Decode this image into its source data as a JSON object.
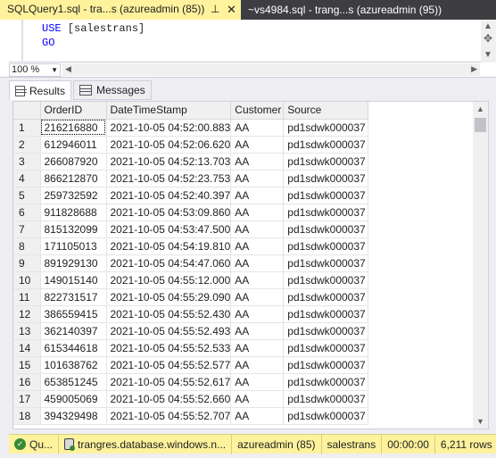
{
  "tabs": {
    "active": {
      "label": "SQLQuery1.sql - tra...s (azureadmin (85))",
      "pin": "⊥",
      "close": "✕"
    },
    "inactive": {
      "label": "~vs4984.sql - trang...s (azureadmin (95))"
    }
  },
  "editor": {
    "line1_keyword": "USE",
    "line1_rest": " [salestrans]",
    "line2_keyword": "GO"
  },
  "zoom": {
    "value": "100 %"
  },
  "results_tabs": {
    "results": "Results",
    "messages": "Messages"
  },
  "grid": {
    "columns": [
      "",
      "OrderID",
      "DateTimeStamp",
      "Customer",
      "Source"
    ],
    "rows": [
      [
        "1",
        "216216880",
        "2021-10-05 04:52:00.883",
        "AA",
        "pd1sdwk000037"
      ],
      [
        "2",
        "612946011",
        "2021-10-05 04:52:06.620",
        "AA",
        "pd1sdwk000037"
      ],
      [
        "3",
        "266087920",
        "2021-10-05 04:52:13.703",
        "AA",
        "pd1sdwk000037"
      ],
      [
        "4",
        "866212870",
        "2021-10-05 04:52:23.753",
        "AA",
        "pd1sdwk000037"
      ],
      [
        "5",
        "259732592",
        "2021-10-05 04:52:40.397",
        "AA",
        "pd1sdwk000037"
      ],
      [
        "6",
        "911828688",
        "2021-10-05 04:53:09.860",
        "AA",
        "pd1sdwk000037"
      ],
      [
        "7",
        "815132099",
        "2021-10-05 04:53:47.500",
        "AA",
        "pd1sdwk000037"
      ],
      [
        "8",
        "171105013",
        "2021-10-05 04:54:19.810",
        "AA",
        "pd1sdwk000037"
      ],
      [
        "9",
        "891929130",
        "2021-10-05 04:54:47.060",
        "AA",
        "pd1sdwk000037"
      ],
      [
        "10",
        "149015140",
        "2021-10-05 04:55:12.000",
        "AA",
        "pd1sdwk000037"
      ],
      [
        "11",
        "822731517",
        "2021-10-05 04:55:29.090",
        "AA",
        "pd1sdwk000037"
      ],
      [
        "12",
        "386559415",
        "2021-10-05 04:55:52.430",
        "AA",
        "pd1sdwk000037"
      ],
      [
        "13",
        "362140397",
        "2021-10-05 04:55:52.493",
        "AA",
        "pd1sdwk000037"
      ],
      [
        "14",
        "615344618",
        "2021-10-05 04:55:52.533",
        "AA",
        "pd1sdwk000037"
      ],
      [
        "15",
        "101638762",
        "2021-10-05 04:55:52.577",
        "AA",
        "pd1sdwk000037"
      ],
      [
        "16",
        "653851245",
        "2021-10-05 04:55:52.617",
        "AA",
        "pd1sdwk000037"
      ],
      [
        "17",
        "459005069",
        "2021-10-05 04:55:52.660",
        "AA",
        "pd1sdwk000037"
      ],
      [
        "18",
        "394329498",
        "2021-10-05 04:55:52.707",
        "AA",
        "pd1sdwk000037"
      ]
    ]
  },
  "status": {
    "state": "Qu...",
    "server": "trangres.database.windows.n...",
    "user": "azureadmin (85)",
    "database": "salestrans",
    "elapsed": "00:00:00",
    "rows": "6,211 rows"
  },
  "colors": {
    "tab_active_bg": "#fff29d",
    "tab_inactive_bg": "#3e3e42",
    "keyword": "#0000ff",
    "status_ok": "#388a34"
  }
}
